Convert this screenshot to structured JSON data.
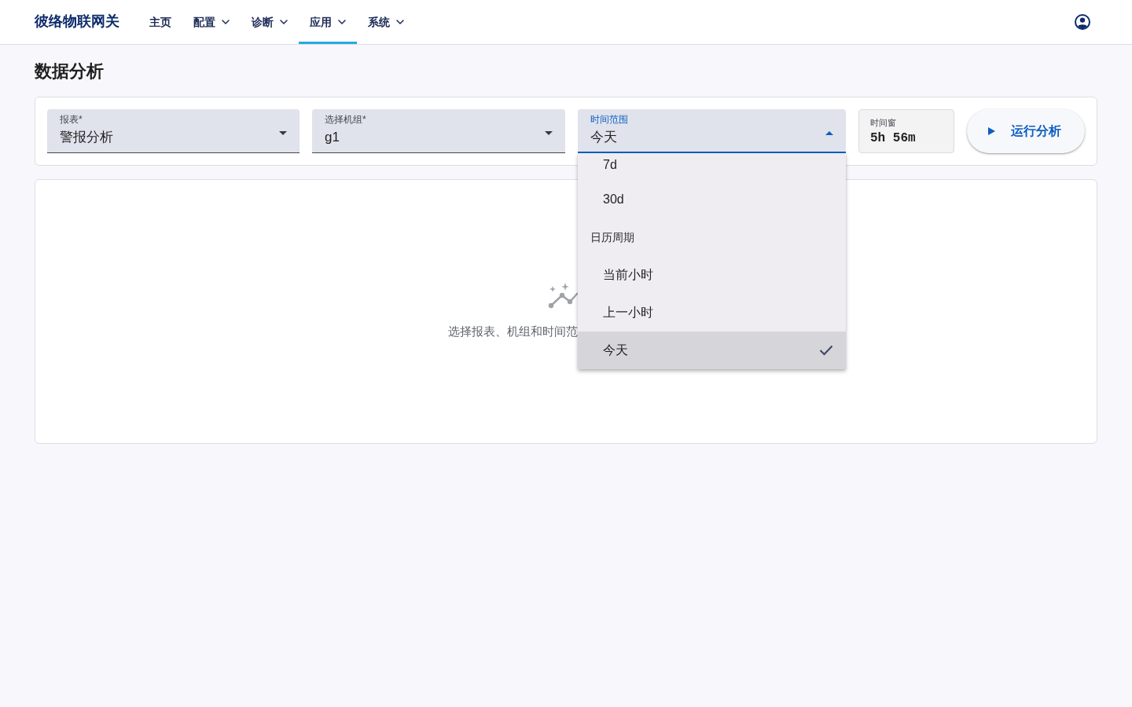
{
  "navbar": {
    "brand": "彼络物联网关",
    "items": [
      {
        "label": "主页",
        "has_menu": false,
        "selected": false
      },
      {
        "label": "配置",
        "has_menu": true,
        "selected": false
      },
      {
        "label": "诊断",
        "has_menu": true,
        "selected": false
      },
      {
        "label": "应用",
        "has_menu": true,
        "selected": true
      },
      {
        "label": "系统",
        "has_menu": true,
        "selected": false
      }
    ]
  },
  "page": {
    "title": "数据分析"
  },
  "filters": {
    "fields": [
      {
        "kind": "select",
        "label": "报表*",
        "value": "警报分析",
        "expanded": false
      },
      {
        "kind": "select",
        "label": "选择机组*",
        "value": "g1",
        "expanded": false
      },
      {
        "kind": "select",
        "label": "时间范围",
        "value": "今天",
        "expanded": true,
        "menu": [
          {
            "kind": "option",
            "label": "7d",
            "selected": false
          },
          {
            "kind": "option",
            "label": "30d",
            "selected": false
          },
          {
            "kind": "header",
            "label": "日历周期"
          },
          {
            "kind": "option",
            "label": "当前小时",
            "selected": false
          },
          {
            "kind": "option",
            "label": "上一小时",
            "selected": false
          },
          {
            "kind": "option",
            "label": "今天",
            "selected": true
          }
        ]
      },
      {
        "kind": "readout",
        "label": "时间窗",
        "value": "5h 56m"
      }
    ],
    "run_button": {
      "label": "运行分析"
    }
  },
  "results": {
    "empty_message": "选择报表、机组和时间范"
  }
}
